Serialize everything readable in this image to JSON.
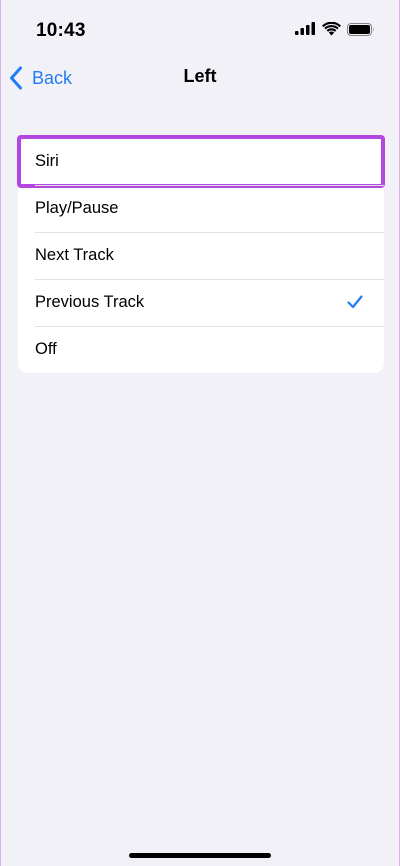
{
  "status_bar": {
    "time": "10:43",
    "icons": [
      "signal-icon",
      "wifi-icon",
      "battery-icon"
    ]
  },
  "nav": {
    "back_label": "Back",
    "title": "Left"
  },
  "options": {
    "items": [
      {
        "label": "Siri",
        "highlighted": true,
        "selected": false
      },
      {
        "label": "Play/Pause",
        "highlighted": false,
        "selected": false
      },
      {
        "label": "Next Track",
        "highlighted": false,
        "selected": false
      },
      {
        "label": "Previous Track",
        "highlighted": false,
        "selected": true
      },
      {
        "label": "Off",
        "highlighted": false,
        "selected": false
      }
    ]
  },
  "colors": {
    "accent": "#1f7cf7",
    "highlight": "#b447e0",
    "background": "#f2f1f7"
  }
}
